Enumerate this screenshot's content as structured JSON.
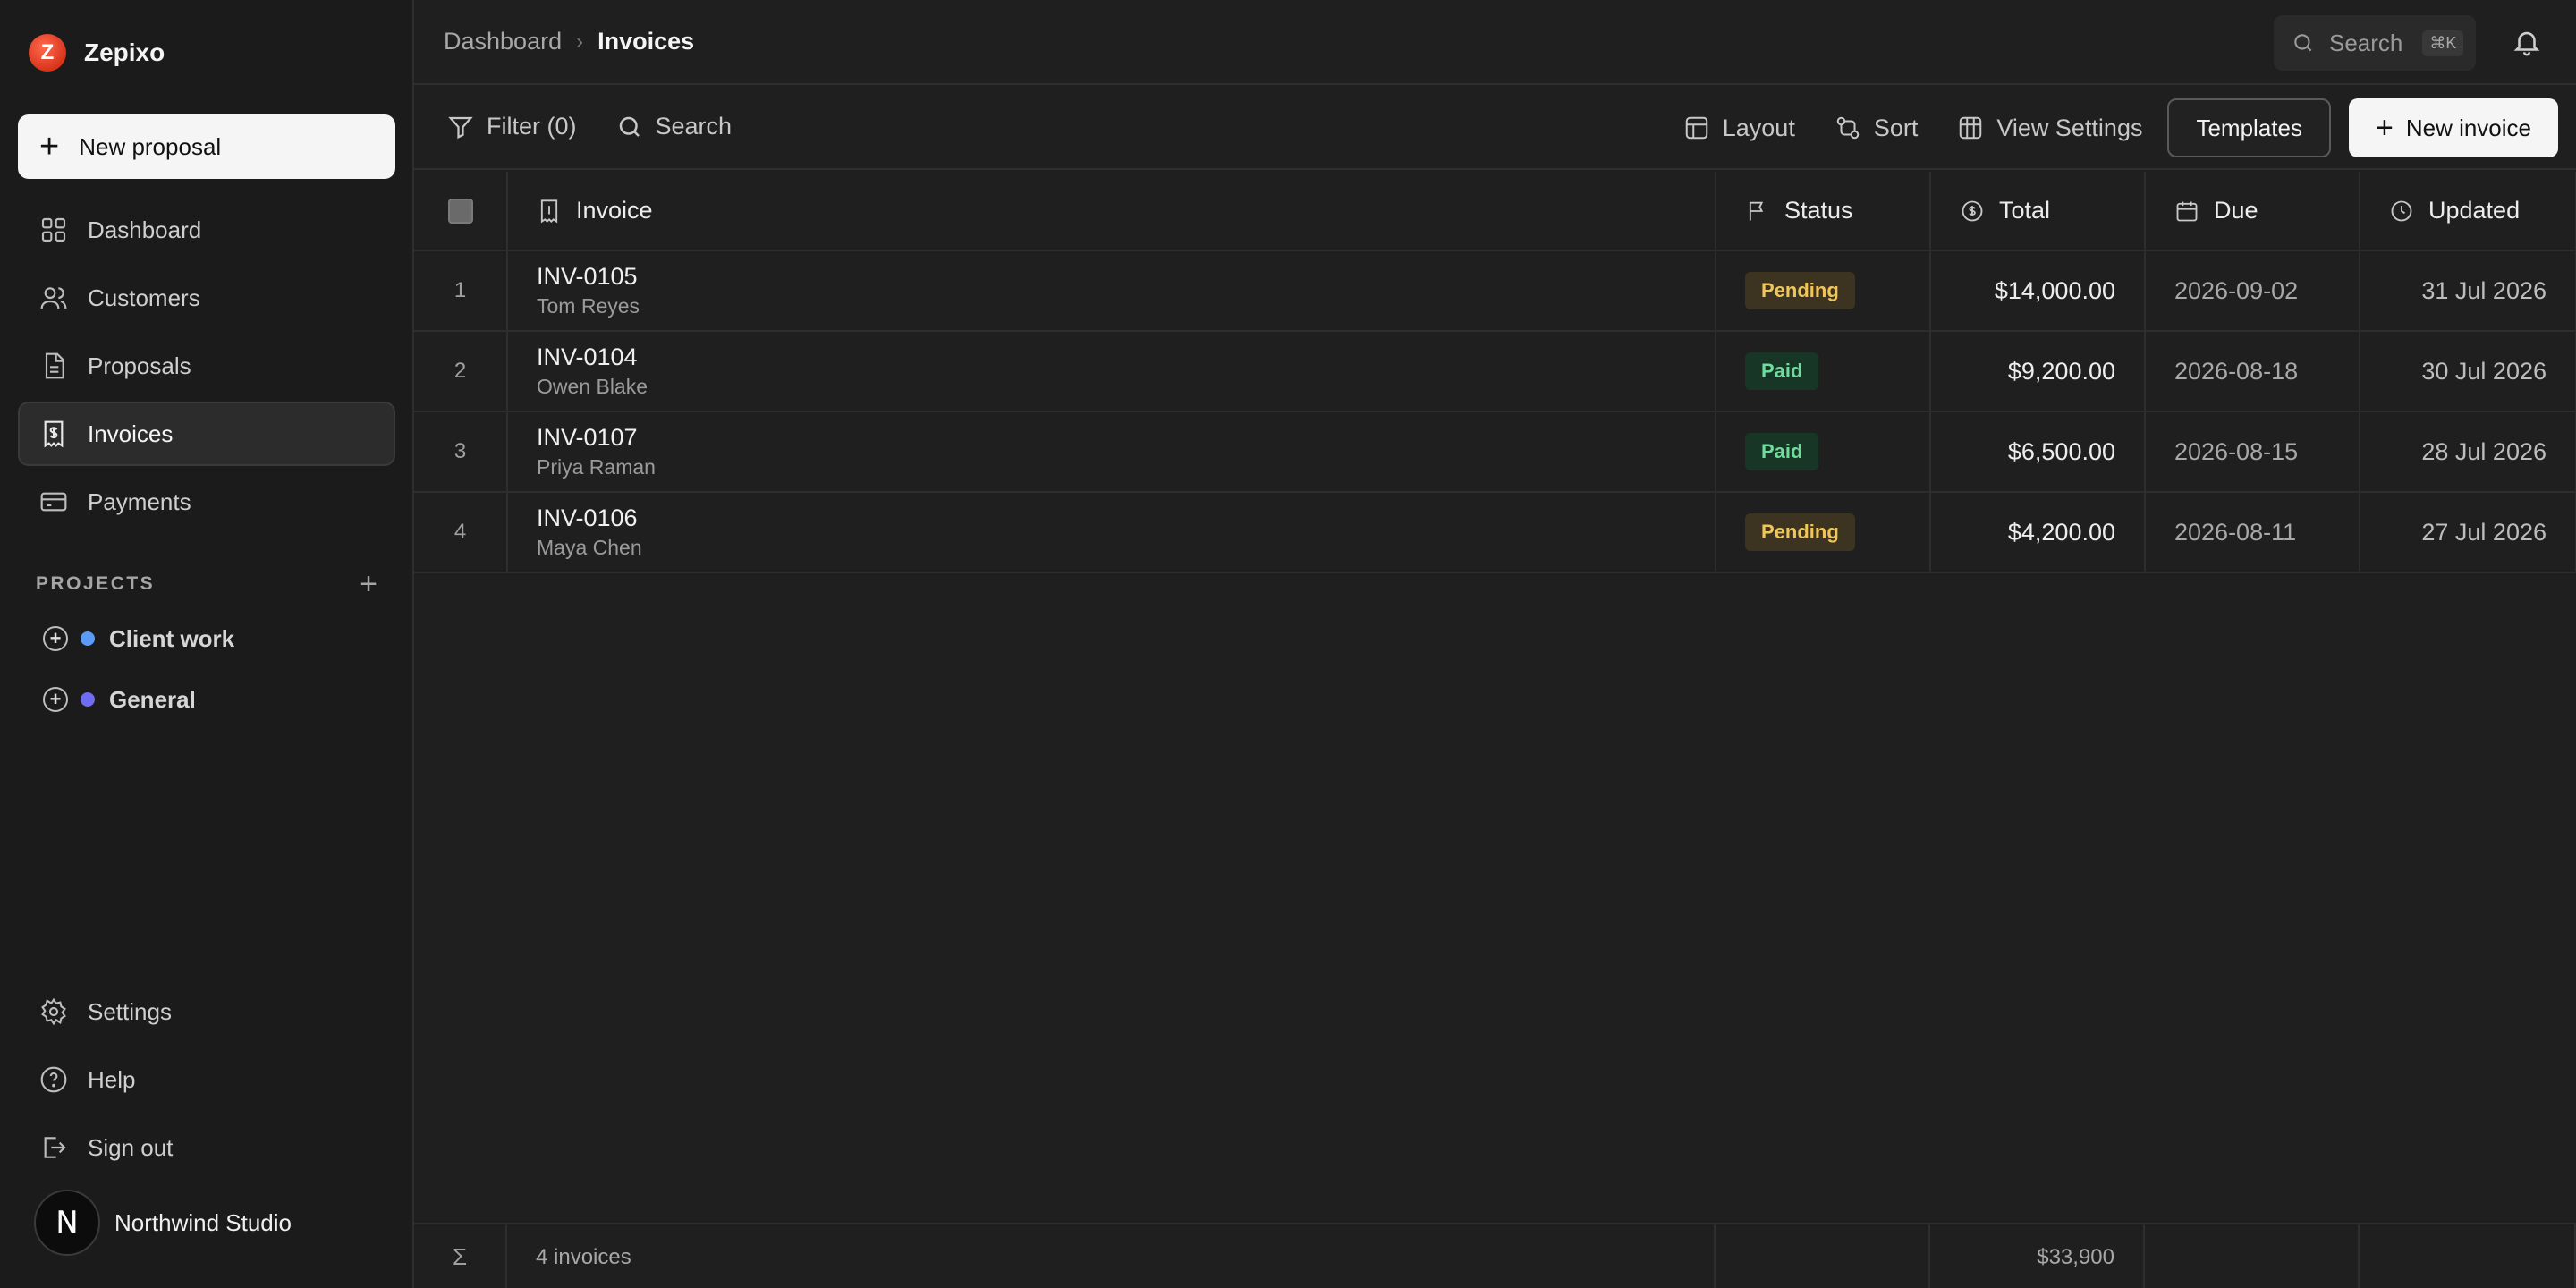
{
  "brand": {
    "name": "Zepixo",
    "logo_letter": "Z"
  },
  "sidebar": {
    "new_button": "New proposal",
    "nav": [
      {
        "label": "Dashboard",
        "icon": "grid-icon"
      },
      {
        "label": "Customers",
        "icon": "users-icon"
      },
      {
        "label": "Proposals",
        "icon": "document-icon"
      },
      {
        "label": "Invoices",
        "icon": "invoice-icon",
        "active": true
      },
      {
        "label": "Payments",
        "icon": "card-icon"
      }
    ],
    "projects_label": "PROJECTS",
    "projects": [
      {
        "label": "Client work",
        "color": "#5b9bf5"
      },
      {
        "label": "General",
        "color": "#6f6cf0"
      }
    ],
    "bottom": [
      {
        "label": "Settings",
        "icon": "gear-icon"
      },
      {
        "label": "Help",
        "icon": "help-icon"
      },
      {
        "label": "Sign out",
        "icon": "sign-out-icon"
      }
    ],
    "account": {
      "initial": "N",
      "name": "Northwind Studio"
    }
  },
  "header": {
    "breadcrumb_root": "Dashboard",
    "breadcrumb_current": "Invoices",
    "search_label": "Search",
    "search_shortcut": "⌘K"
  },
  "toolbar": {
    "filter": "Filter (0)",
    "search": "Search",
    "layout": "Layout",
    "sort": "Sort",
    "view_settings": "View Settings",
    "templates": "Templates",
    "new_invoice": "New invoice"
  },
  "table": {
    "columns": {
      "invoice": "Invoice",
      "status": "Status",
      "total": "Total",
      "due": "Due",
      "updated": "Updated"
    },
    "rows": [
      {
        "idx": "1",
        "id": "INV-0105",
        "customer": "Tom Reyes",
        "status": "Pending",
        "total": "$14,000.00",
        "due": "2026-09-02",
        "updated": "31 Jul 2026"
      },
      {
        "idx": "2",
        "id": "INV-0104",
        "customer": "Owen Blake",
        "status": "Paid",
        "total": "$9,200.00",
        "due": "2026-08-18",
        "updated": "30 Jul 2026"
      },
      {
        "idx": "3",
        "id": "INV-0107",
        "customer": "Priya Raman",
        "status": "Paid",
        "total": "$6,500.00",
        "due": "2026-08-15",
        "updated": "28 Jul 2026"
      },
      {
        "idx": "4",
        "id": "INV-0106",
        "customer": "Maya Chen",
        "status": "Pending",
        "total": "$4,200.00",
        "due": "2026-08-11",
        "updated": "27 Jul 2026"
      }
    ],
    "footer": {
      "sigma": "Σ",
      "count": "4 invoices",
      "total": "$33,900"
    }
  },
  "colors": {
    "pending_badge": "#f0c65a",
    "paid_badge": "#6fdc9c",
    "brand": "#e0401f"
  }
}
